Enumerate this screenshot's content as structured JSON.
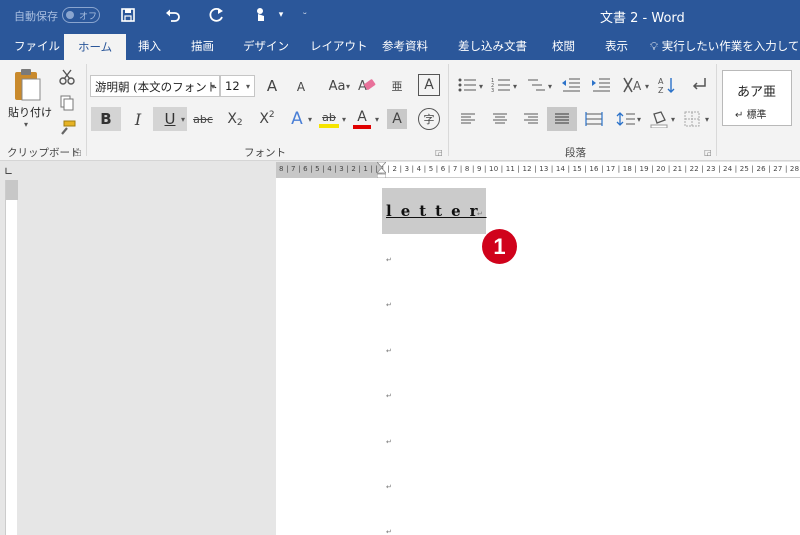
{
  "titlebar": {
    "autosave_label": "自動保存",
    "autosave_state": "オフ",
    "doc_title": "文書 2  -  Word",
    "qat_icons": [
      "save-icon",
      "undo-icon",
      "redo-icon",
      "touch-mode-icon",
      "customize-qat-icon"
    ]
  },
  "tabs": {
    "file": "ファイル",
    "home": "ホーム",
    "insert": "挿入",
    "draw": "描画",
    "design": "デザイン",
    "layout": "レイアウト",
    "references": "参考資料",
    "mailings": "差し込み文書",
    "review": "校閲",
    "view": "表示",
    "tell_me": "実行したい作業を入力してくだ",
    "active_tab": "ホーム"
  },
  "ribbon": {
    "clipboard": {
      "paste_label": "貼り付け",
      "group_label": "クリップボード"
    },
    "font": {
      "font_name": "游明朝 (本文のフォント - ",
      "font_size": "12",
      "grow_font": "A",
      "shrink_font": "A",
      "change_case": "Aa",
      "bold": "B",
      "italic": "I",
      "underline": "U",
      "strikethrough": "abc",
      "subscript": "X",
      "superscript": "X",
      "text_effect": "A",
      "highlight": "ab",
      "font_color": "A",
      "char_shading": "A",
      "enclose": "字",
      "phonetic": "亜",
      "char_border": "A",
      "group_label": "フォント",
      "highlight_color": "#f5e400",
      "font_color_value": "#e00000"
    },
    "paragraph": {
      "group_label": "段落"
    },
    "styles": {
      "sample": "あア亜",
      "name": "標準"
    }
  },
  "ruler": {
    "numbers": "8 | 7 | 6 | 5 | 4 | 3 | 2 | 1 |   | 1 | 2 | 3 | 4 | 5 | 6 | 7 | 8 | 9 | 10 | 11 | 12 | 13 | 14 | 15 | 16 | 17 | 18 | 19 | 20 | 21 | 22 | 23 | 24 | 25 | 26 | 27 | 28 | 29 |"
  },
  "document": {
    "heading_text": "letter",
    "paragraph_mark": "↵",
    "annotation_number": "❶",
    "accent_color": "#2b579a"
  }
}
